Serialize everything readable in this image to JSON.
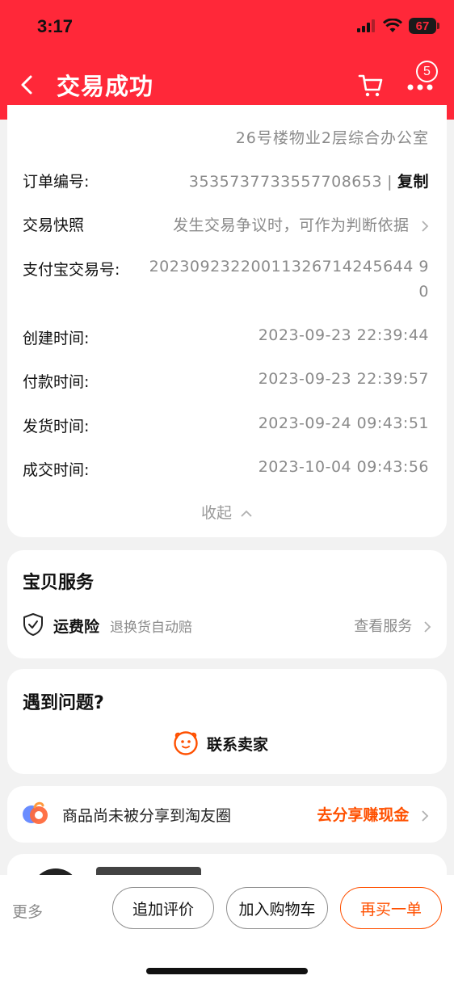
{
  "status_bar": {
    "time": "3:17",
    "battery": "67"
  },
  "header": {
    "title": "交易成功",
    "cart_badge": "5"
  },
  "order": {
    "address_tail": "26号楼物业2层综合办公室",
    "rows": [
      {
        "label": "订单编号:",
        "value": "3535737733557708653"
      },
      {
        "label": "交易快照",
        "value": "发生交易争议时，可作为判断依据"
      },
      {
        "label": "支付宝交易号:",
        "value_line1": "20230923220011326714245644 9",
        "value_line2": "0"
      },
      {
        "label": "创建时间:",
        "value": "2023-09-23 22:39:44"
      },
      {
        "label": "付款时间:",
        "value": "2023-09-23 22:39:57"
      },
      {
        "label": "发货时间:",
        "value": "2023-09-24 09:43:51"
      },
      {
        "label": "成交时间:",
        "value": "2023-10-04 09:43:56"
      }
    ],
    "copy_label": "复制",
    "separator": "|",
    "collapse_label": "收起"
  },
  "service": {
    "title": "宝贝服务",
    "name": "运费险",
    "desc": "退换货自动赔",
    "link": "查看服务"
  },
  "problem": {
    "title": "遇到问题?",
    "contact": "联系卖家"
  },
  "share": {
    "text": "商品尚未被分享到淘友圈",
    "link": "去分享赚现金"
  },
  "bottom": {
    "more": "更多",
    "review": "追加评价",
    "add_cart": "加入购物车",
    "rebuy": "再买一单"
  },
  "colors": {
    "brand_red": "#ff2839",
    "accent_orange": "#ff5000"
  }
}
